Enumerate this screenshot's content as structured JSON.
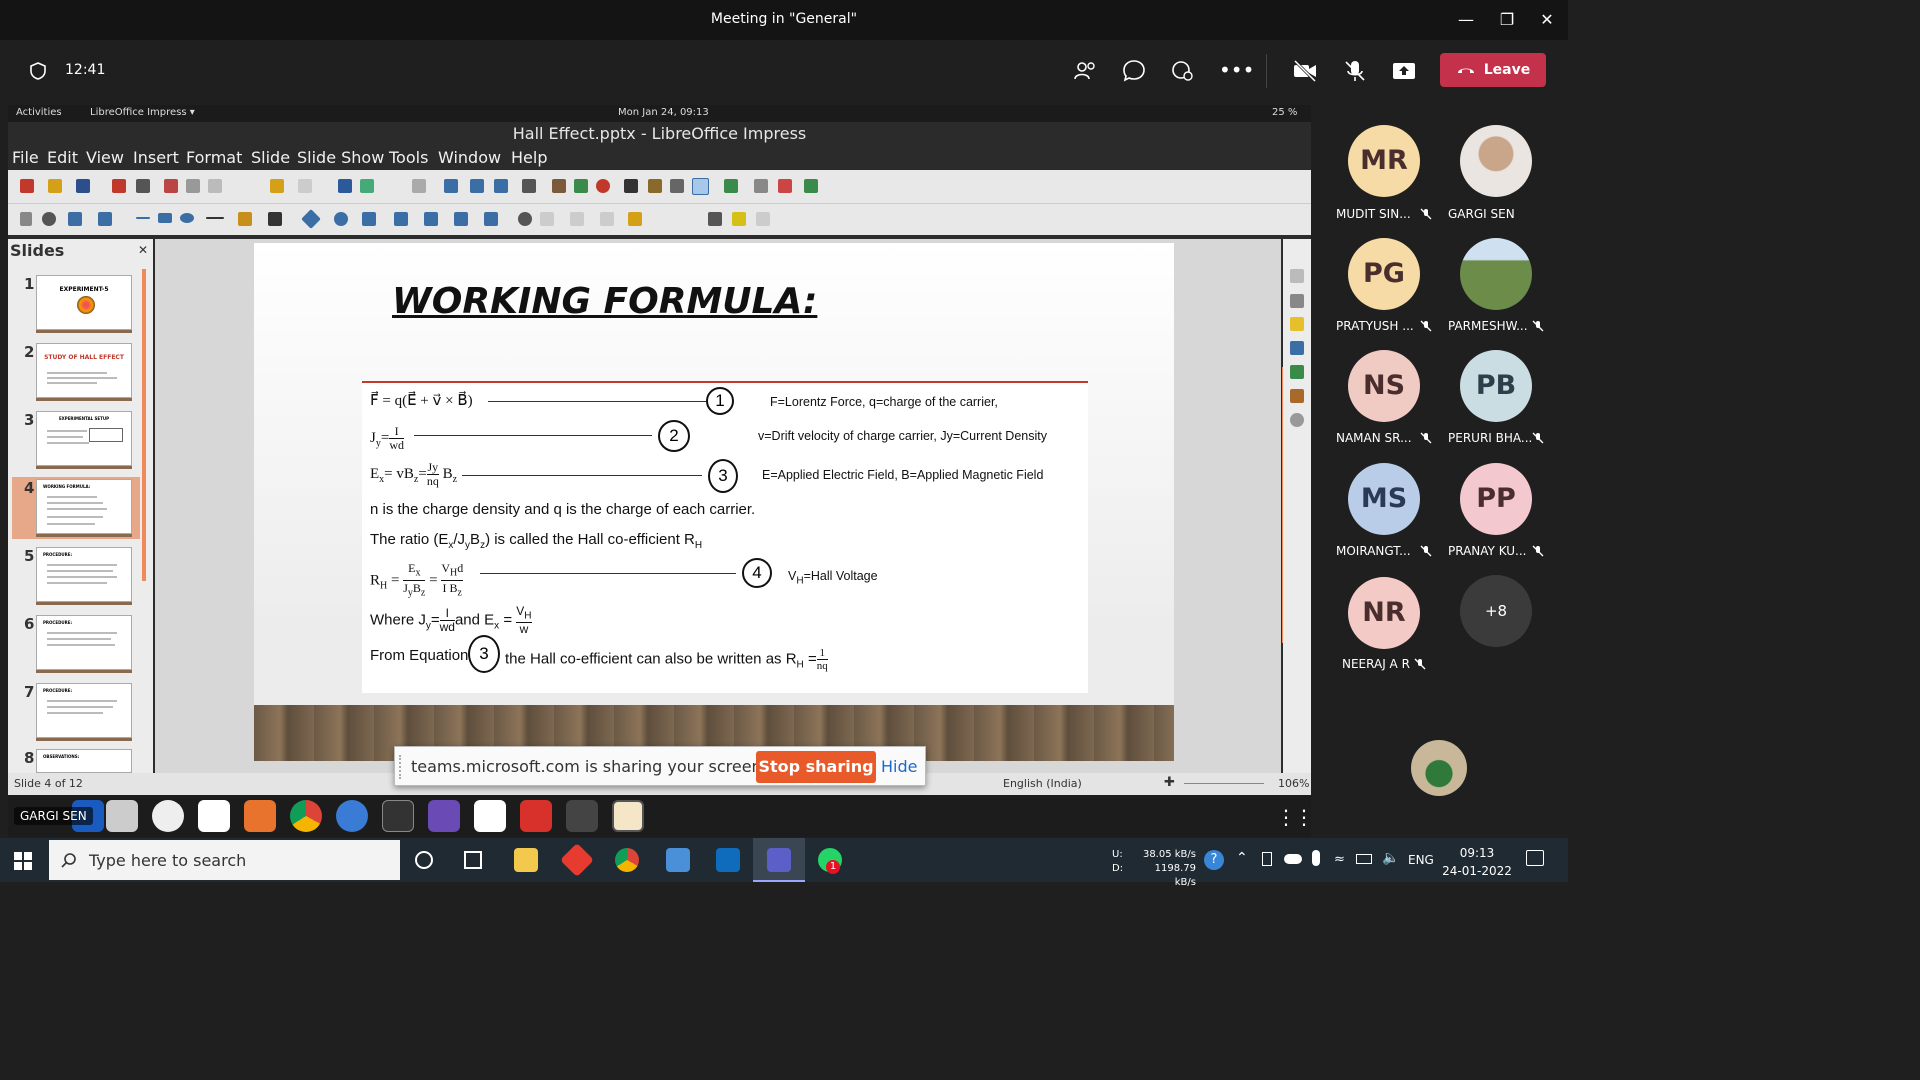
{
  "teams": {
    "window_title": "Meeting in \"General\"",
    "timer": "12:41",
    "leave_label": "Leave"
  },
  "ubuntu": {
    "activities": "Activities",
    "app_menu": "LibreOffice Impress ▾",
    "datetime": "Mon Jan 24, 09:13",
    "battery": "25 %"
  },
  "impress": {
    "title": "Hall Effect.pptx - LibreOffice Impress",
    "menu": [
      "File",
      "Edit",
      "View",
      "Insert",
      "Format",
      "Slide",
      "Slide Show",
      "Tools",
      "Window",
      "Help"
    ],
    "slides_header": "Slides",
    "thumbnails": [
      {
        "num": "1",
        "title": "EXPERIMENT-5"
      },
      {
        "num": "2",
        "title": "STUDY OF HALL EFFECT"
      },
      {
        "num": "3",
        "title": "EXPERIMENTAL SETUP"
      },
      {
        "num": "4",
        "title": "WORKING FORMULA:"
      },
      {
        "num": "5",
        "title": "PROCEDURE:"
      },
      {
        "num": "6",
        "title": "PROCEDURE:"
      },
      {
        "num": "7",
        "title": "PROCEDURE:"
      },
      {
        "num": "8",
        "title": "OBSERVATIONS:"
      }
    ],
    "status_slide": "Slide 4 of 12",
    "status_lang": "English (India)",
    "zoom": "106%"
  },
  "slide": {
    "title": "WORKING FORMULA:",
    "eq_nums": [
      "1",
      "2",
      "3",
      "4",
      "3"
    ],
    "note1": "F=Lorentz Force, q=charge of the carrier,",
    "note2": "v=Drift velocity of charge carrier, Jy=Current Density",
    "note3": "E=Applied Electric Field, B=Applied Magnetic Field",
    "line_n": "n is the charge density and q is the charge of each carrier.",
    "line_ratio_a": "The ratio (E",
    "line_ratio_b": ") is called the Hall co-efficient R",
    "note4": "=Hall Voltage",
    "from_eq_a": "From Equation",
    "from_eq_b": "the Hall co-efficient can also be written as R"
  },
  "share_banner": {
    "message": "teams.microsoft.com is sharing your screen.",
    "stop": "Stop sharing",
    "hide": "Hide"
  },
  "presenter_label": "GARGI SEN",
  "participants": [
    {
      "initials": "MR",
      "name": "MUDIT SIN...",
      "color": "#f6dba6"
    },
    {
      "initials": "",
      "name": "GARGI SEN",
      "color": "#d9c7b8"
    },
    {
      "initials": "PG",
      "name": "PRATYUSH ...",
      "color": "#f6dba6"
    },
    {
      "initials": "",
      "name": "PARMESHW...",
      "color": "#6c8d4a"
    },
    {
      "initials": "NS",
      "name": "NAMAN SR...",
      "color": "#f0cbc4"
    },
    {
      "initials": "PB",
      "name": "PERURI BHA...",
      "color": "#c9dde2"
    },
    {
      "initials": "MS",
      "name": "MOIRANGT...",
      "color": "#b9cde8"
    },
    {
      "initials": "PP",
      "name": "PRANAY KU...",
      "color": "#f3c9cf"
    },
    {
      "initials": "NR",
      "name": "NEERAJ A R",
      "color": "#f3cac6"
    },
    {
      "initials": "+8",
      "name": "",
      "color": "#3b3b3b"
    }
  ],
  "windows": {
    "search_placeholder": "Type here to search",
    "net_up": "38.05 kB/s",
    "net_down": "1198.79 kB/s",
    "net_up_label": "U:",
    "net_down_label": "D:",
    "lang": "ENG",
    "time": "09:13",
    "date": "24-01-2022",
    "whatsapp_badge": "1"
  }
}
